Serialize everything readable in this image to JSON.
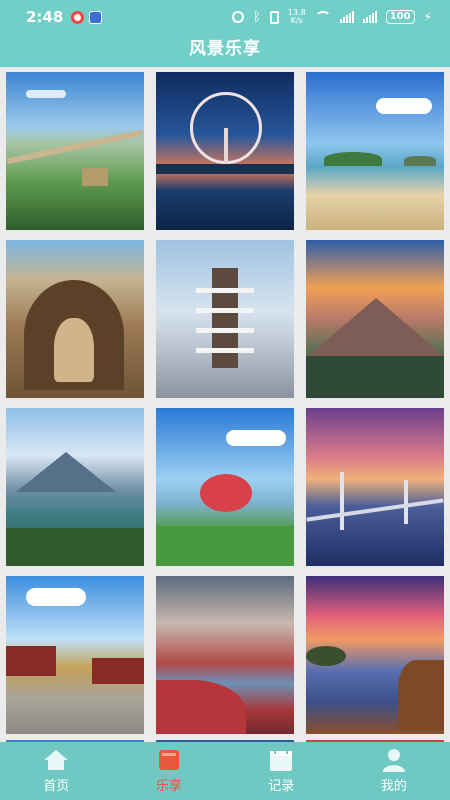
{
  "status_bar": {
    "time": "2:48",
    "net_speed_top": "13.8",
    "net_speed_bottom": "K/s",
    "battery": "100"
  },
  "header": {
    "title": "风景乐享"
  },
  "tiles": [
    {
      "name": "great-wall"
    },
    {
      "name": "ferris-wheel-night"
    },
    {
      "name": "island-beach"
    },
    {
      "name": "grotto-buddha"
    },
    {
      "name": "snow-pagoda"
    },
    {
      "name": "mountain-sunset"
    },
    {
      "name": "coastal-mountains"
    },
    {
      "name": "red-sculpture-city"
    },
    {
      "name": "cable-bridge-dusk"
    },
    {
      "name": "ancient-temple"
    },
    {
      "name": "red-wetland"
    },
    {
      "name": "sunset-lake"
    }
  ],
  "bottom_nav": {
    "active_color": "#e8583c",
    "items": [
      {
        "label": "首页",
        "icon": "home-icon"
      },
      {
        "label": "乐享",
        "icon": "book-icon"
      },
      {
        "label": "记录",
        "icon": "calendar-icon"
      },
      {
        "label": "我的",
        "icon": "user-icon"
      }
    ]
  }
}
